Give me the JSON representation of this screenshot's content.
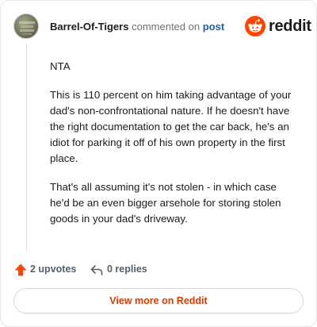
{
  "header": {
    "username": "Barrel-Of-Tigers",
    "action_text": "commented on",
    "post_link": "post",
    "logo_text": "reddit"
  },
  "comment": {
    "paragraphs": [
      "NTA",
      "This is 110 percent on him taking advantage of your dad's non-confrontational nature. If he doesn't have the right documentation to get the car back, he's an idiot for parking it off of his own property in the first place.",
      "That's all assuming it's not stolen - in which case he'd be an even bigger arsehole for storing stolen goods in your dad's driveway."
    ]
  },
  "footer": {
    "upvotes_label": "2 upvotes",
    "replies_label": "0 replies",
    "view_more_label": "View more on Reddit"
  },
  "colors": {
    "accent": "#d93a00",
    "reddit_orange": "#ff4500",
    "upvote": "#ff4500",
    "link": "#1a5fb4",
    "muted": "#576068"
  },
  "icons": {
    "avatar": "user-avatar",
    "logo": "reddit-alien-icon",
    "upvote": "upvote-arrow-icon",
    "reply": "reply-arrow-icon"
  }
}
